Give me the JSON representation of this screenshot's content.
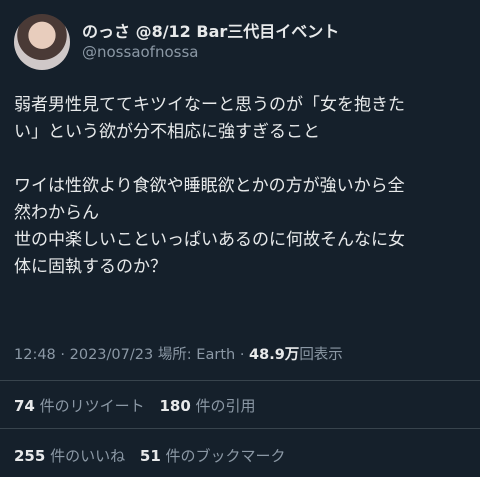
{
  "user": {
    "display_name": "のっさ @8/12 Bar三代目イベント",
    "handle": "@nossaofnossa"
  },
  "tweet": {
    "lines": [
      "弱者男性見ててキツイなーと思うのが「女を抱きた",
      "い」という欲が分不相応に強すぎること",
      "",
      "ワイは性欲より食欲や睡眠欲とかの方が強いから全",
      "然わからん",
      "世の中楽しいこといっぱいあるのに何故そんなに女",
      "体に固執するのか？"
    ]
  },
  "meta": {
    "time": "12:48",
    "sep1": "·",
    "date": "2023/07/23",
    "location": "場所: Earth",
    "sep2": "·",
    "views_count": "48.9万",
    "views_label": "回表示"
  },
  "stats": {
    "retweets_count": "74",
    "retweets_label": "件のリツイート",
    "quotes_count": "180",
    "quotes_label": "件の引用",
    "likes_count": "255",
    "likes_label": "件のいいね",
    "bookmarks_count": "51",
    "bookmarks_label": "件のブックマーク"
  },
  "colors": {
    "background": "#15202b",
    "text": "#e7e9ea",
    "secondary": "#8b98a5",
    "divider": "#38444d"
  }
}
